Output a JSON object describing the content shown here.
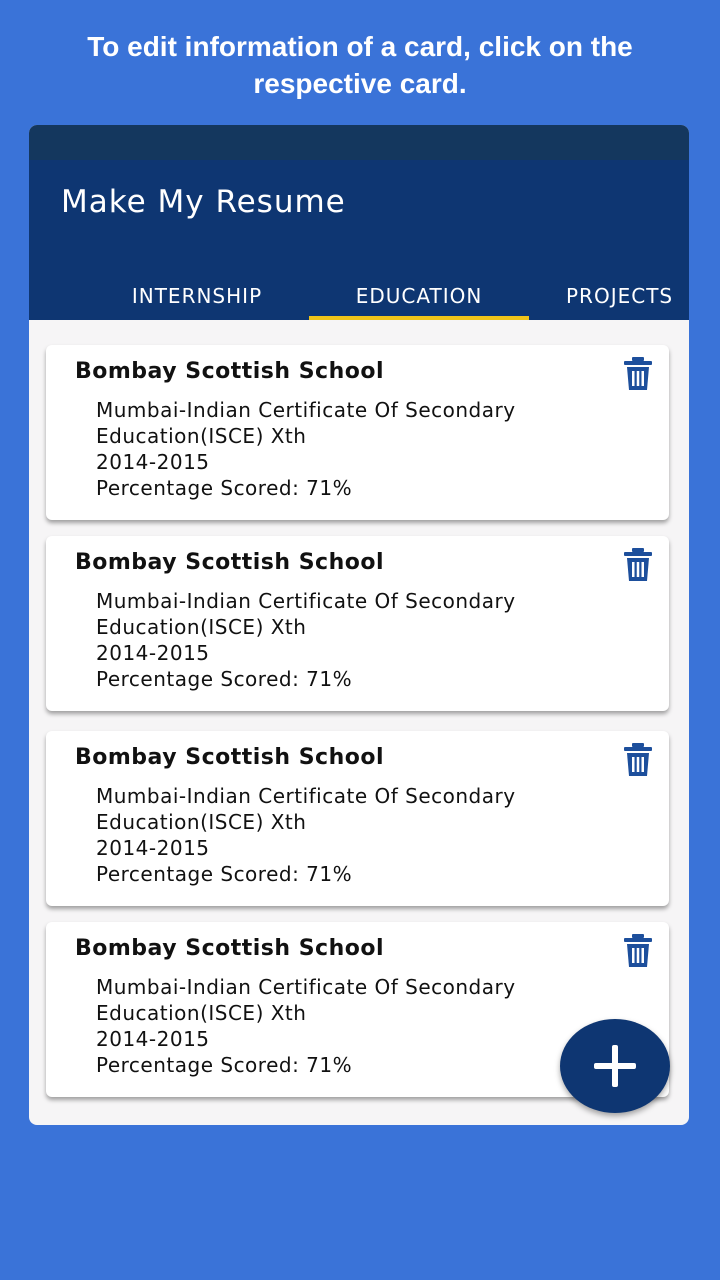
{
  "caption": "To edit information of a card, click on the respective card.",
  "app": {
    "title": "Make My Resume"
  },
  "tabs": [
    {
      "label": "INTERNSHIP"
    },
    {
      "label": "EDUCATION"
    },
    {
      "label": "PROJECTS"
    }
  ],
  "active_tab": "EDUCATION",
  "cards": [
    {
      "title": "Bombay Scottish School",
      "line1": "Mumbai-Indian Certificate Of Secondary",
      "line2": "Education(ISCE) Xth",
      "years": "2014-2015",
      "score": "Percentage Scored: 71%"
    },
    {
      "title": "Bombay Scottish School",
      "line1": "Mumbai-Indian Certificate Of Secondary",
      "line2": "Education(ISCE) Xth",
      "years": "2014-2015",
      "score": "Percentage Scored: 71%"
    },
    {
      "title": "Bombay Scottish School",
      "line1": "Mumbai-Indian Certificate Of Secondary",
      "line2": "Education(ISCE) Xth",
      "years": "2014-2015",
      "score": "Percentage Scored: 71%"
    },
    {
      "title": "Bombay Scottish School",
      "line1": "Mumbai-Indian Certificate Of Secondary",
      "line2": "Education(ISCE) Xth",
      "years": "2014-2015",
      "score": "Percentage Scored: 71%"
    }
  ],
  "icons": {
    "delete": "trash-icon",
    "add": "plus-icon"
  },
  "colors": {
    "background": "#3a73d8",
    "appbar": "#0e3672",
    "statusbar": "#14375e",
    "tab_indicator": "#f0c419",
    "trash": "#1d4f9c"
  }
}
